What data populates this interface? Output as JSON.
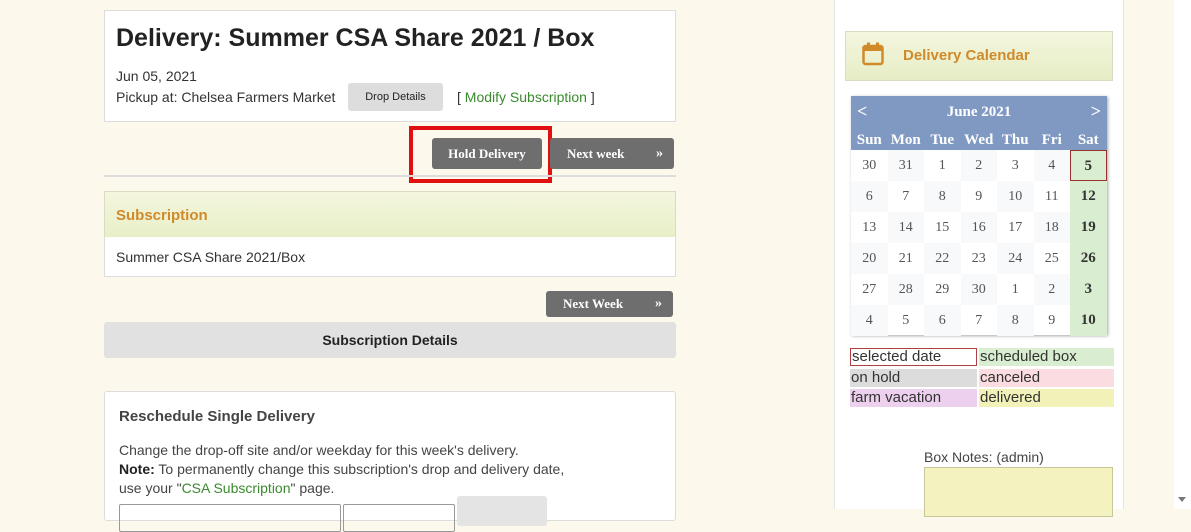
{
  "delivery": {
    "title": "Delivery: Summer CSA Share 2021 / Box",
    "date": "Jun 05, 2021",
    "pickup_label": "Pickup at: Chelsea Farmers Market",
    "drop_details_label": "Drop Details",
    "modify_open": "[ ",
    "modify_label": "Modify Subscription",
    "modify_close": " ]"
  },
  "actions": {
    "hold_label": "Hold Delivery",
    "next_week_label": "Next week",
    "next_week2_label": "Next Week",
    "subscription_details_label": "Subscription Details"
  },
  "subscription": {
    "header": "Subscription",
    "item": "Summer CSA Share 2021/Box"
  },
  "reschedule": {
    "title": "Reschedule Single Delivery",
    "line1": "Change the drop-off site and/or weekday for this week's delivery.",
    "note_label": "Note:",
    "line2": " To permanently change this subscription's drop and delivery date,",
    "line3_pre": "use your \"",
    "line3_link": "CSA Subscription",
    "line3_post": "\" page."
  },
  "sidebar": {
    "calendar_title": "Delivery Calendar",
    "month_label": "June 2021",
    "prev": "<",
    "next": ">",
    "weekdays": [
      "Sun",
      "Mon",
      "Tue",
      "Wed",
      "Thu",
      "Fri",
      "Sat"
    ],
    "weeks": [
      [
        "30",
        "31",
        "1",
        "2",
        "3",
        "4",
        "5"
      ],
      [
        "6",
        "7",
        "8",
        "9",
        "10",
        "11",
        "12"
      ],
      [
        "13",
        "14",
        "15",
        "16",
        "17",
        "18",
        "19"
      ],
      [
        "20",
        "21",
        "22",
        "23",
        "24",
        "25",
        "26"
      ],
      [
        "27",
        "28",
        "29",
        "30",
        "1",
        "2",
        "3"
      ],
      [
        "4",
        "5",
        "6",
        "7",
        "8",
        "9",
        "10"
      ]
    ],
    "selected_day": "5",
    "legend": {
      "selected": "selected date",
      "scheduled": "scheduled box",
      "on_hold": "on hold",
      "canceled": "canceled",
      "farm_vacation": "farm vacation",
      "delivered": "delivered"
    },
    "box_notes_label": "Box Notes: (admin)"
  },
  "colors": {
    "accent_orange": "#d08a2a",
    "link_green": "#3a8a2e",
    "highlight_red": "#e01010",
    "scheduled": "#d9edd0",
    "canceled": "#fbdce0",
    "farm_vacation": "#ecd0ee",
    "delivered": "#f2f1b8",
    "on_hold": "#dcdcdc"
  }
}
